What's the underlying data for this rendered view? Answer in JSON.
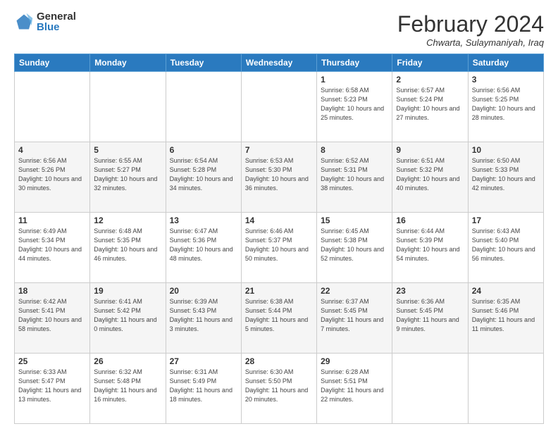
{
  "logo": {
    "general": "General",
    "blue": "Blue"
  },
  "title": "February 2024",
  "location": "Chwarta, Sulaymaniyah, Iraq",
  "days_header": [
    "Sunday",
    "Monday",
    "Tuesday",
    "Wednesday",
    "Thursday",
    "Friday",
    "Saturday"
  ],
  "weeks": [
    [
      {
        "day": "",
        "info": ""
      },
      {
        "day": "",
        "info": ""
      },
      {
        "day": "",
        "info": ""
      },
      {
        "day": "",
        "info": ""
      },
      {
        "day": "1",
        "info": "Sunrise: 6:58 AM\nSunset: 5:23 PM\nDaylight: 10 hours and 25 minutes."
      },
      {
        "day": "2",
        "info": "Sunrise: 6:57 AM\nSunset: 5:24 PM\nDaylight: 10 hours and 27 minutes."
      },
      {
        "day": "3",
        "info": "Sunrise: 6:56 AM\nSunset: 5:25 PM\nDaylight: 10 hours and 28 minutes."
      }
    ],
    [
      {
        "day": "4",
        "info": "Sunrise: 6:56 AM\nSunset: 5:26 PM\nDaylight: 10 hours and 30 minutes."
      },
      {
        "day": "5",
        "info": "Sunrise: 6:55 AM\nSunset: 5:27 PM\nDaylight: 10 hours and 32 minutes."
      },
      {
        "day": "6",
        "info": "Sunrise: 6:54 AM\nSunset: 5:28 PM\nDaylight: 10 hours and 34 minutes."
      },
      {
        "day": "7",
        "info": "Sunrise: 6:53 AM\nSunset: 5:30 PM\nDaylight: 10 hours and 36 minutes."
      },
      {
        "day": "8",
        "info": "Sunrise: 6:52 AM\nSunset: 5:31 PM\nDaylight: 10 hours and 38 minutes."
      },
      {
        "day": "9",
        "info": "Sunrise: 6:51 AM\nSunset: 5:32 PM\nDaylight: 10 hours and 40 minutes."
      },
      {
        "day": "10",
        "info": "Sunrise: 6:50 AM\nSunset: 5:33 PM\nDaylight: 10 hours and 42 minutes."
      }
    ],
    [
      {
        "day": "11",
        "info": "Sunrise: 6:49 AM\nSunset: 5:34 PM\nDaylight: 10 hours and 44 minutes."
      },
      {
        "day": "12",
        "info": "Sunrise: 6:48 AM\nSunset: 5:35 PM\nDaylight: 10 hours and 46 minutes."
      },
      {
        "day": "13",
        "info": "Sunrise: 6:47 AM\nSunset: 5:36 PM\nDaylight: 10 hours and 48 minutes."
      },
      {
        "day": "14",
        "info": "Sunrise: 6:46 AM\nSunset: 5:37 PM\nDaylight: 10 hours and 50 minutes."
      },
      {
        "day": "15",
        "info": "Sunrise: 6:45 AM\nSunset: 5:38 PM\nDaylight: 10 hours and 52 minutes."
      },
      {
        "day": "16",
        "info": "Sunrise: 6:44 AM\nSunset: 5:39 PM\nDaylight: 10 hours and 54 minutes."
      },
      {
        "day": "17",
        "info": "Sunrise: 6:43 AM\nSunset: 5:40 PM\nDaylight: 10 hours and 56 minutes."
      }
    ],
    [
      {
        "day": "18",
        "info": "Sunrise: 6:42 AM\nSunset: 5:41 PM\nDaylight: 10 hours and 58 minutes."
      },
      {
        "day": "19",
        "info": "Sunrise: 6:41 AM\nSunset: 5:42 PM\nDaylight: 11 hours and 0 minutes."
      },
      {
        "day": "20",
        "info": "Sunrise: 6:39 AM\nSunset: 5:43 PM\nDaylight: 11 hours and 3 minutes."
      },
      {
        "day": "21",
        "info": "Sunrise: 6:38 AM\nSunset: 5:44 PM\nDaylight: 11 hours and 5 minutes."
      },
      {
        "day": "22",
        "info": "Sunrise: 6:37 AM\nSunset: 5:45 PM\nDaylight: 11 hours and 7 minutes."
      },
      {
        "day": "23",
        "info": "Sunrise: 6:36 AM\nSunset: 5:45 PM\nDaylight: 11 hours and 9 minutes."
      },
      {
        "day": "24",
        "info": "Sunrise: 6:35 AM\nSunset: 5:46 PM\nDaylight: 11 hours and 11 minutes."
      }
    ],
    [
      {
        "day": "25",
        "info": "Sunrise: 6:33 AM\nSunset: 5:47 PM\nDaylight: 11 hours and 13 minutes."
      },
      {
        "day": "26",
        "info": "Sunrise: 6:32 AM\nSunset: 5:48 PM\nDaylight: 11 hours and 16 minutes."
      },
      {
        "day": "27",
        "info": "Sunrise: 6:31 AM\nSunset: 5:49 PM\nDaylight: 11 hours and 18 minutes."
      },
      {
        "day": "28",
        "info": "Sunrise: 6:30 AM\nSunset: 5:50 PM\nDaylight: 11 hours and 20 minutes."
      },
      {
        "day": "29",
        "info": "Sunrise: 6:28 AM\nSunset: 5:51 PM\nDaylight: 11 hours and 22 minutes."
      },
      {
        "day": "",
        "info": ""
      },
      {
        "day": "",
        "info": ""
      }
    ]
  ]
}
